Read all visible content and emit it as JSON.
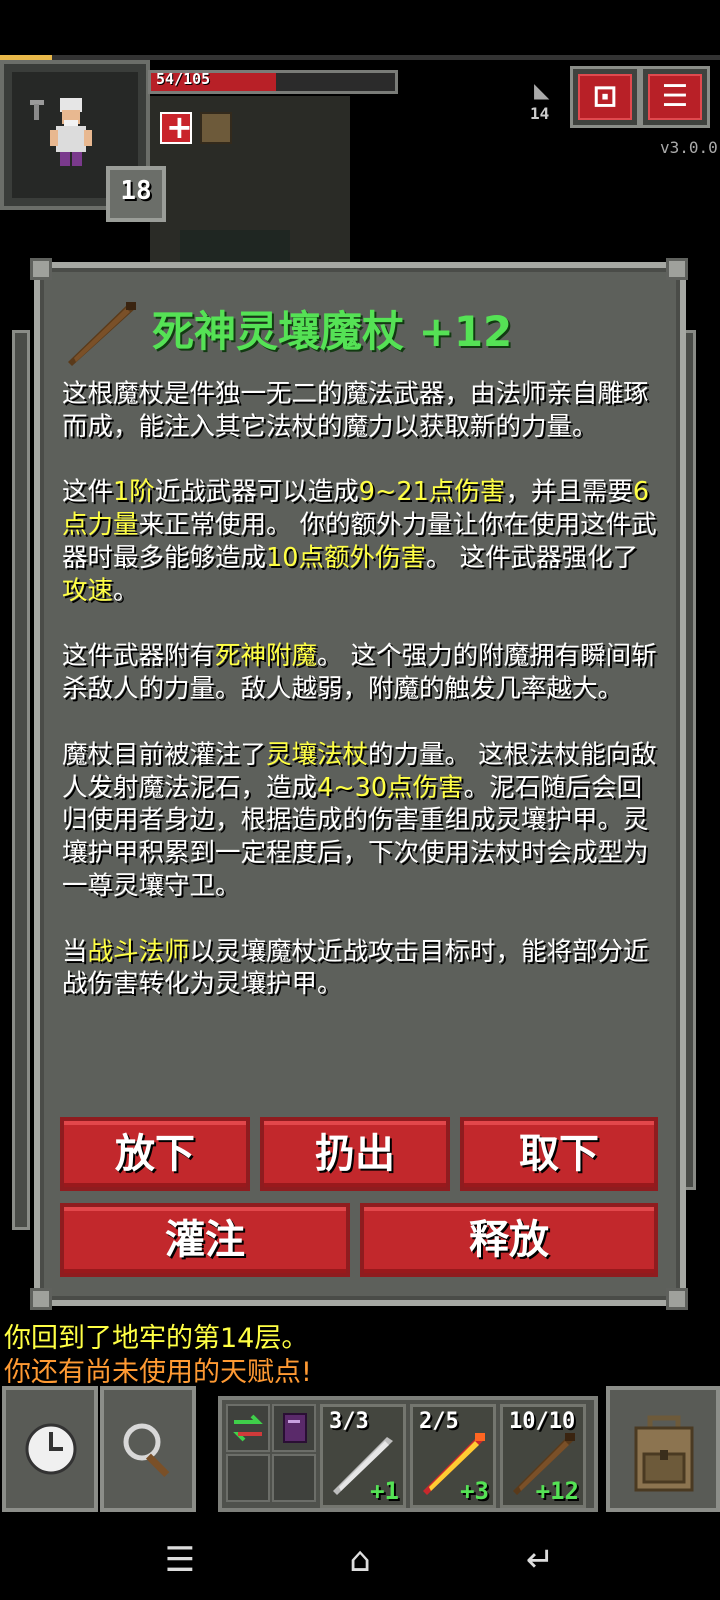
{
  "status": {
    "hp_text": "54/105",
    "hp_fraction": 0.514,
    "level": "18",
    "depth": "14",
    "version": "v3.0.0"
  },
  "dialog": {
    "title": "死神灵壤魔杖 +12",
    "p1": "这根魔杖是件独一无二的魔法武器，由法师亲自雕琢而成，能注入其它法杖的魔力以获取新的力量。",
    "p2": {
      "t1": "这件",
      "h1": "1阶",
      "t2": "近战武器可以造成",
      "h2": "9~21点伤害",
      "t3": "，并且需要",
      "h3": "6点力量",
      "t4": "来正常使用。 你的额外力量让你在使用这件武器时最多能够造成",
      "h4": "10点额外伤害",
      "t5": "。 这件武器强化了",
      "h5": "攻速",
      "t6": "。"
    },
    "p3": {
      "t1": "这件武器附有",
      "h1": "死神附魔",
      "t2": "。 这个强力的附魔拥有瞬间斩杀敌人的力量。敌人越弱，附魔的触发几率越大。"
    },
    "p4": {
      "t1": "魔杖目前被灌注了",
      "h1": "灵壤法杖",
      "t2": "的力量。 这根法杖能向敌人发射魔法泥石，造成",
      "h2": "4~30点伤害",
      "t3": "。泥石随后会回归使用者身边，根据造成的伤害重组成灵壤护甲。灵壤护甲积累到一定程度后，下次使用法杖时会成型为一尊灵壤守卫。"
    },
    "p5": {
      "t1": "当",
      "h1": "战斗法师",
      "t2": "以灵壤魔杖近战攻击目标时，能将部分近战伤害转化为灵壤护甲。"
    },
    "buttons": {
      "drop": "放下",
      "throw": "扔出",
      "unequip": "取下",
      "imbue": "灌注",
      "release": "释放"
    }
  },
  "log": [
    "你回到了地牢的第14层。",
    "你还有尚未使用的天赋点!"
  ],
  "quickslots": [
    {
      "charges": "3/3",
      "plus": "+1"
    },
    {
      "charges": "2/5",
      "plus": "+3"
    },
    {
      "charges": "10/10",
      "plus": "+12"
    }
  ],
  "colors": {
    "title_green": "#55e255",
    "highlight_yellow": "#ffff44",
    "log_orange": "#ff9a33",
    "button_red": "#c2282c"
  }
}
